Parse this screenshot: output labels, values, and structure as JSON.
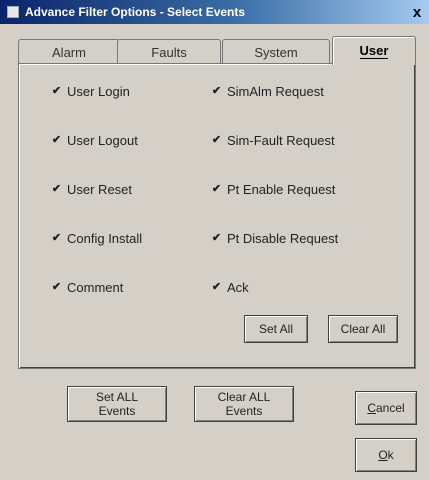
{
  "window": {
    "title": "Advance Filter Options - Select Events",
    "close_glyph": "x"
  },
  "tabs": [
    {
      "label": "Alarm",
      "active": false
    },
    {
      "label": "Faults",
      "active": false
    },
    {
      "label": "System",
      "active": false
    },
    {
      "label": "User",
      "active": true
    }
  ],
  "user_tab": {
    "checkboxes_left": [
      {
        "label": "User Login",
        "checked": true
      },
      {
        "label": "User Logout",
        "checked": true
      },
      {
        "label": "User Reset",
        "checked": true
      },
      {
        "label": "Config Install",
        "checked": true
      },
      {
        "label": "Comment",
        "checked": true
      }
    ],
    "checkboxes_right": [
      {
        "label": "SimAlm Request",
        "checked": true
      },
      {
        "label": "Sim-Fault Request",
        "checked": true
      },
      {
        "label": "Pt Enable Request",
        "checked": true
      },
      {
        "label": "Pt Disable Request",
        "checked": true
      },
      {
        "label": "Ack",
        "checked": true
      }
    ],
    "set_all_label": "Set All",
    "clear_all_label": "Clear All"
  },
  "footer": {
    "set_all_events_line1": "Set ALL",
    "set_all_events_line2": "Events",
    "clear_all_events_line1": "Clear ALL",
    "clear_all_events_line2": "Events",
    "cancel_label": "Cancel",
    "ok_label": "Ok"
  },
  "check_glyph": "✔"
}
